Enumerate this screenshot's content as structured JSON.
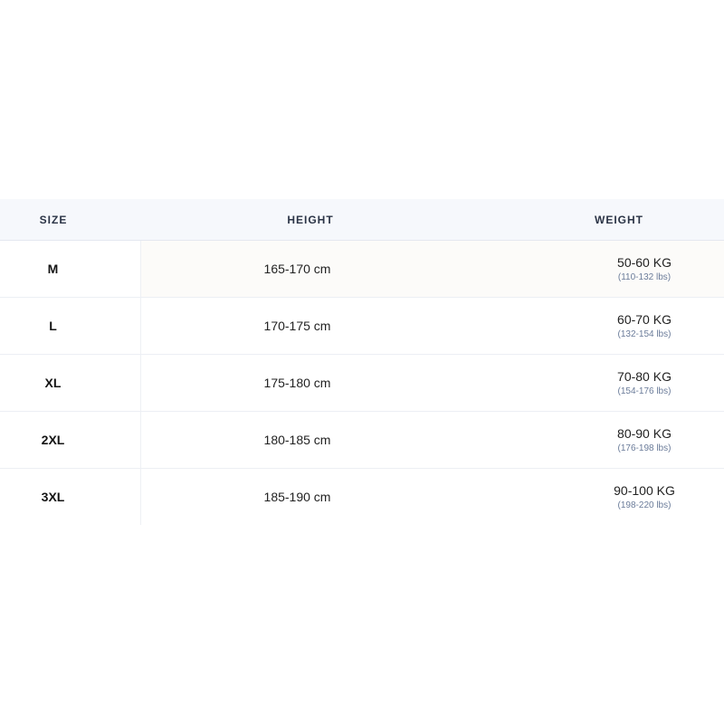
{
  "table": {
    "headers": {
      "size": "SIZE",
      "height": "HEIGHT",
      "weight": "WEIGHT"
    },
    "rows": [
      {
        "size": "M",
        "height": "165-170 cm",
        "weight": "50-60 KG",
        "weight_lbs": "(110-132 lbs)"
      },
      {
        "size": "L",
        "height": "170-175 cm",
        "weight": "60-70 KG",
        "weight_lbs": "(132-154 lbs)"
      },
      {
        "size": "XL",
        "height": "175-180 cm",
        "weight": "70-80 KG",
        "weight_lbs": "(154-176 lbs)"
      },
      {
        "size": "2XL",
        "height": "180-185 cm",
        "weight": "80-90 KG",
        "weight_lbs": "(176-198 lbs)"
      },
      {
        "size": "3XL",
        "height": "185-190 cm",
        "weight": "90-100 KG",
        "weight_lbs": "(198-220 lbs)"
      }
    ]
  },
  "colors": {
    "header_bg": "#f6f8fc",
    "header_text": "#2b3446",
    "sub_text": "#6b7c9a",
    "highlight_row": "#fcfbf9"
  }
}
